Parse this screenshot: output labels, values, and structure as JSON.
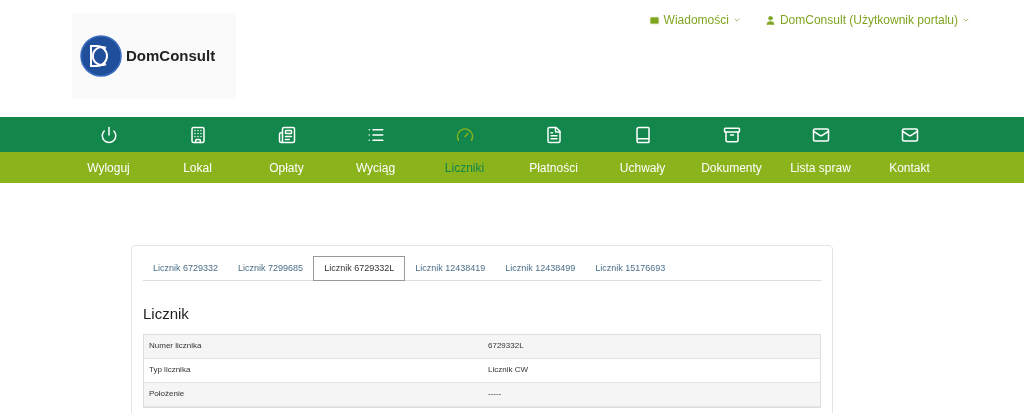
{
  "header": {
    "logo_text": "DomConsult",
    "messages": "Wiadomości",
    "user": "DomConsult (Użytkownik portalu)"
  },
  "nav": [
    {
      "label": "Wyloguj",
      "selected": false
    },
    {
      "label": "Lokal",
      "selected": false
    },
    {
      "label": "Opłaty",
      "selected": false
    },
    {
      "label": "Wyciąg",
      "selected": false
    },
    {
      "label": "Liczniki",
      "selected": true
    },
    {
      "label": "Płatności",
      "selected": false
    },
    {
      "label": "Uchwały",
      "selected": false
    },
    {
      "label": "Dokumenty",
      "selected": false
    },
    {
      "label": "Lista spraw",
      "selected": false
    },
    {
      "label": "Kontakt",
      "selected": false
    }
  ],
  "tabs": [
    {
      "label": "Licznik 6729332",
      "selected": false
    },
    {
      "label": "Licznik 7299685",
      "selected": false
    },
    {
      "label": "Licznik 6729332L",
      "selected": true
    },
    {
      "label": "Licznik 12438419",
      "selected": false
    },
    {
      "label": "Licznik 12438499",
      "selected": false
    },
    {
      "label": "Licznik 15176693",
      "selected": false
    }
  ],
  "section_title": "Licznik",
  "rows": [
    {
      "label": "Numer licznika",
      "value": "6729332L"
    },
    {
      "label": "Typ licznika",
      "value": "Licznik CW"
    },
    {
      "label": "Położenie",
      "value": "-----"
    }
  ]
}
